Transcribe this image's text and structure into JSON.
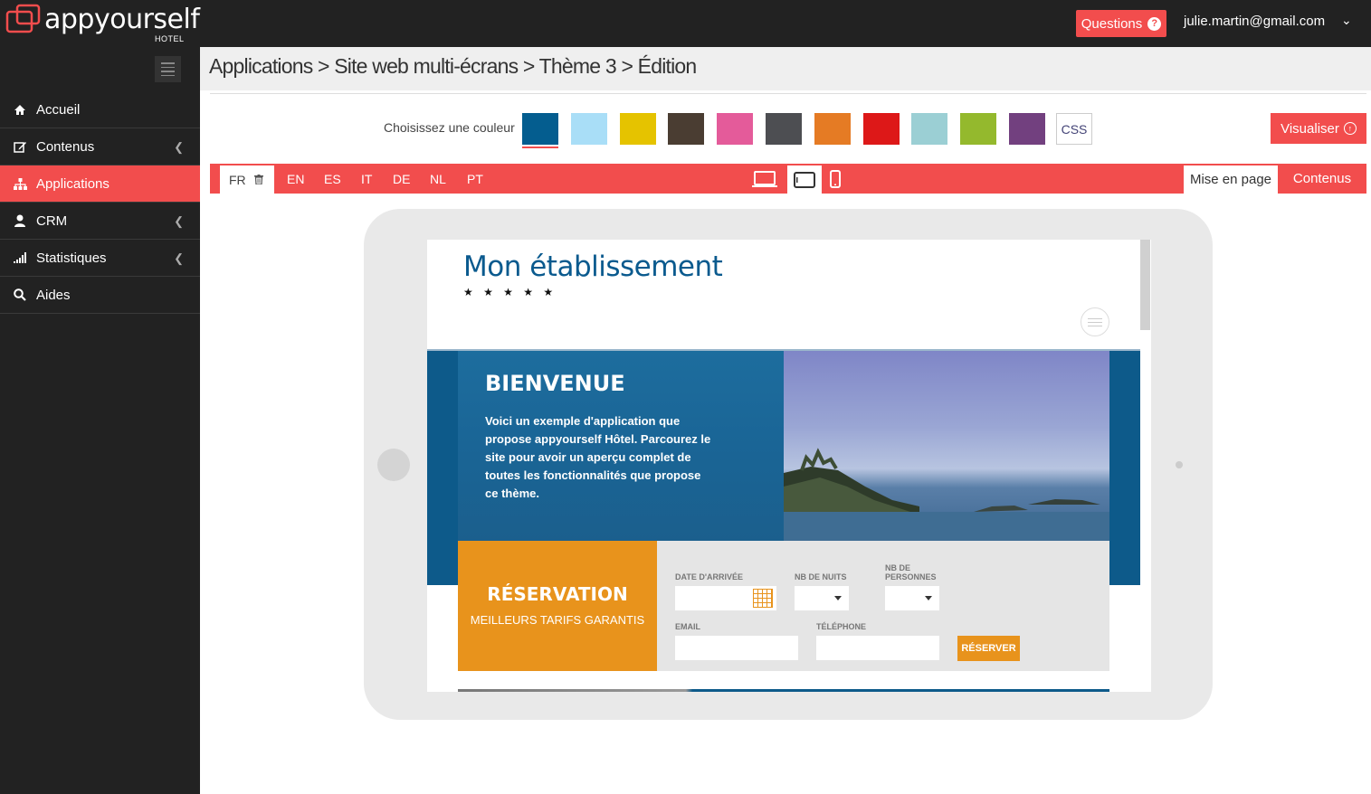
{
  "app": {
    "logo_text": "appyourself",
    "logo_sub": "HOTEL",
    "questions_label": "Questions",
    "user_email": "julie.martin@gmail.com"
  },
  "sidebar": {
    "items": [
      {
        "label": "Accueil",
        "icon": "home-icon",
        "active": false
      },
      {
        "label": "Contenus",
        "icon": "edit-icon",
        "active": false,
        "chevron": true
      },
      {
        "label": "Applications",
        "icon": "sitemap-icon",
        "active": true
      },
      {
        "label": "CRM",
        "icon": "user-icon",
        "active": false,
        "chevron": true
      },
      {
        "label": "Statistiques",
        "icon": "signal-bars-icon",
        "active": false,
        "chevron": true
      },
      {
        "label": "Aides",
        "icon": "search-icon",
        "active": false
      }
    ]
  },
  "breadcrumb": "Applications > Site web multi-écrans > Thème 3 > Édition",
  "colors": {
    "label": "Choisissez une couleur",
    "swatches": [
      "#045d8f",
      "#a9def7",
      "#e5c300",
      "#4a3d32",
      "#e45b9a",
      "#4d4e52",
      "#e57b24",
      "#dd1818",
      "#9bcfd4",
      "#94b92d",
      "#72407f"
    ],
    "selected_index": 0,
    "css_label": "CSS",
    "accent": "#f24d4d"
  },
  "visualiser_label": "Visualiser",
  "languages": [
    "FR",
    "EN",
    "ES",
    "IT",
    "DE",
    "NL",
    "PT"
  ],
  "active_language": "FR",
  "tabs": {
    "layout": "Mise en page",
    "contents": "Contenus"
  },
  "preview": {
    "site_title": "Mon établissement",
    "stars": "★ ★ ★ ★ ★",
    "hero_title": "BIENVENUE",
    "hero_text": "Voici un exemple d'application que propose appyourself Hôtel. Parcourez le site pour avoir un aperçu complet de toutes les fonctionnalités que propose ce thème.",
    "resa_title": "RÉSERVATION",
    "resa_sub": "MEILLEURS TARIFS GARANTIS",
    "labels": {
      "arrival": "DATE D'ARRIVÉE",
      "nights": "NB DE NUITS",
      "persons_line1": "NB DE",
      "persons_line2": "PERSONNES",
      "email": "EMAIL",
      "phone": "TÉLÉPHONE"
    },
    "reserve_button": "RÉSERVER"
  }
}
